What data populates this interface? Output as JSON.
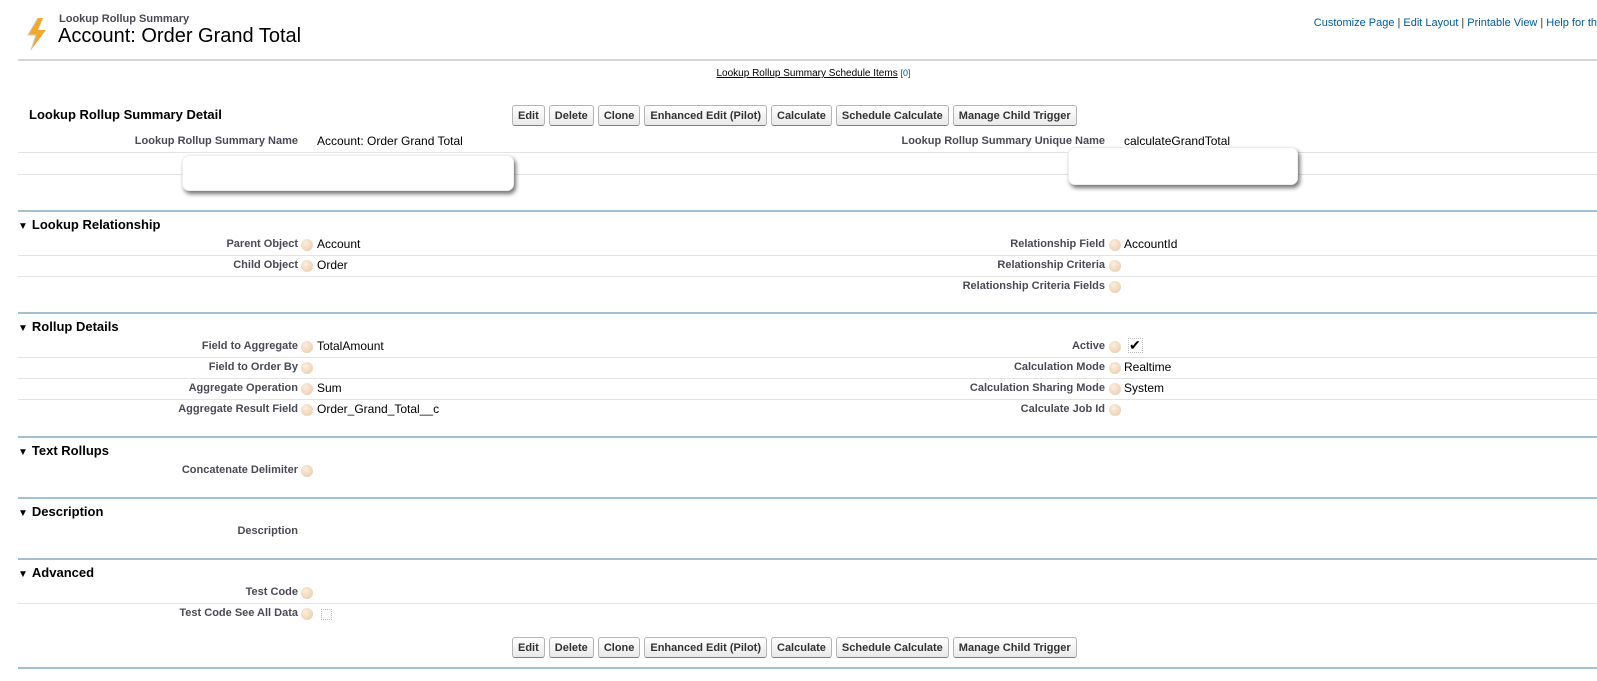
{
  "header": {
    "subtitle": "Lookup Rollup Summary",
    "title": "Account: Order Grand Total",
    "links": [
      "Customize Page",
      "Edit Layout",
      "Printable View",
      "Help for th"
    ]
  },
  "schedule_link": {
    "label": "Lookup Rollup Summary Schedule Items",
    "count": "[0]"
  },
  "detail": {
    "title": "Lookup Rollup Summary Detail",
    "buttons": [
      "Edit",
      "Delete",
      "Clone",
      "Enhanced Edit (Pilot)",
      "Calculate",
      "Schedule Calculate",
      "Manage Child Trigger"
    ],
    "name_label": "Lookup Rollup Summary Name",
    "name_value": "Account: Order Grand Total",
    "unique_label": "Lookup Rollup Summary Unique Name",
    "unique_value": "calculateGrandTotal"
  },
  "sections": [
    {
      "title": "Lookup Relationship",
      "rows": [
        {
          "l": "Parent Object",
          "lv": "Account",
          "r": "Relationship Field",
          "rv": "AccountId"
        },
        {
          "l": "Child Object",
          "lv": "Order",
          "r": "Relationship Criteria",
          "rv": ""
        },
        {
          "l": "",
          "lv": "",
          "r": "Relationship Criteria Fields",
          "rv": ""
        }
      ]
    },
    {
      "title": "Rollup Details",
      "rows": [
        {
          "l": "Field to Aggregate",
          "lv": "TotalAmount",
          "r": "Active",
          "rv": "",
          "rcheck": true
        },
        {
          "l": "Field to Order By",
          "lv": "",
          "r": "Calculation Mode",
          "rv": "Realtime"
        },
        {
          "l": "Aggregate Operation",
          "lv": "Sum",
          "r": "Calculation Sharing Mode",
          "rv": "System"
        },
        {
          "l": "Aggregate Result Field",
          "lv": "Order_Grand_Total__c",
          "r": "Calculate Job Id",
          "rv": ""
        }
      ]
    },
    {
      "title": "Text Rollups",
      "rows": [
        {
          "l": "Concatenate Delimiter",
          "lv": ""
        }
      ]
    },
    {
      "title": "Description",
      "rows": [
        {
          "l": "Description",
          "lv": "",
          "nohelp": true
        }
      ]
    },
    {
      "title": "Advanced",
      "rows": [
        {
          "l": "Test Code",
          "lv": ""
        },
        {
          "l": "Test Code See All Data",
          "lv": "",
          "lcheck": false
        }
      ]
    }
  ],
  "colors": {
    "link": "#015ba7",
    "section_border": "#a3bfd4",
    "label": "#4a4a56"
  }
}
